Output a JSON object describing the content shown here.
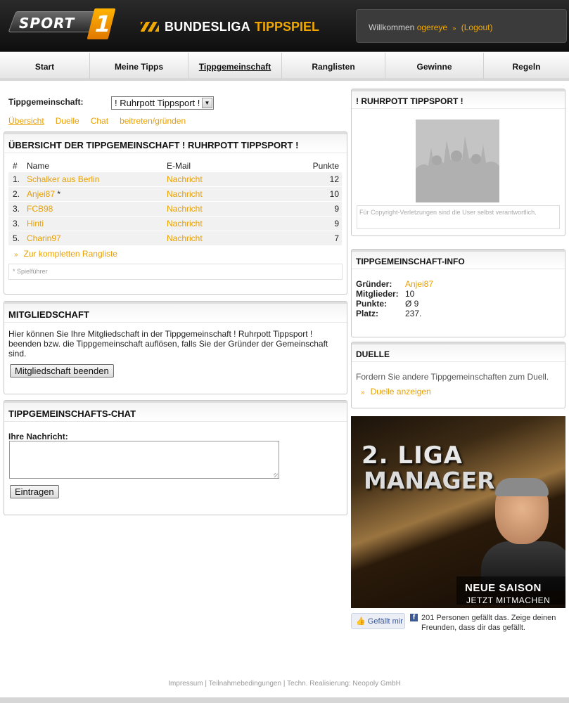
{
  "header": {
    "logo_text": "SPORT",
    "logo_one": "1",
    "brand_main": "BUNDESLIGA",
    "brand_accent": "TIPPSPIEL",
    "welcome_text": "Willkommen",
    "username": "ogereye",
    "logout": "(Logout)"
  },
  "nav": [
    {
      "label": "Start"
    },
    {
      "label": "Meine Tipps"
    },
    {
      "label": "Tippgemeinschaft",
      "active": true
    },
    {
      "label": "Ranglisten"
    },
    {
      "label": "Gewinne"
    },
    {
      "label": "Regeln"
    }
  ],
  "tip": {
    "label": "Tippgemeinschaft:",
    "selected": "! Ruhrpott Tippsport !"
  },
  "subtabs": [
    {
      "label": "Übersicht",
      "active": true
    },
    {
      "label": "Duelle"
    },
    {
      "label": "Chat"
    },
    {
      "label": "beitreten/gründen"
    }
  ],
  "overview": {
    "title": "ÜBERSICHT DER TIPPGEMEINSCHAFT ! RUHRPOTT TIPPSPORT !",
    "columns": [
      "#",
      "Name",
      "E-Mail",
      "Punkte"
    ],
    "rows": [
      {
        "rank": "1.",
        "name": "Schalker aus Berlin",
        "mark": "",
        "email": "Nachricht",
        "points": "12"
      },
      {
        "rank": "2.",
        "name": "Anjei87",
        "mark": "*",
        "email": "Nachricht",
        "points": "10"
      },
      {
        "rank": "3.",
        "name": "FCB98",
        "mark": "",
        "email": "Nachricht",
        "points": "9"
      },
      {
        "rank": "3.",
        "name": "Hinti",
        "mark": "",
        "email": "Nachricht",
        "points": "9"
      },
      {
        "rank": "5.",
        "name": "Charin97",
        "mark": "",
        "email": "Nachricht",
        "points": "7"
      }
    ],
    "more": "Zur kompletten Rangliste",
    "note": "* Spielführer"
  },
  "membership": {
    "title": "MITGLIEDSCHAFT",
    "text": "Hier können Sie Ihre Mitgliedschaft in der Tippgemeinschaft ! Ruhrpott Tippsport ! beenden bzw. die Tippgemeinschaft auflösen, falls Sie der Gründer der Gemeinschaft sind.",
    "button": "Mitgliedschaft beenden"
  },
  "chat": {
    "title": "TIPPGEMEINSCHAFTS-CHAT",
    "label": "Ihre Nachricht:",
    "button": "Eintragen"
  },
  "side_group": {
    "title": "! RUHRPOTT TIPPSPORT !",
    "copyright": "Für Copyright-Verletzungen sind die User selbst verantwortlich."
  },
  "info": {
    "title": "TIPPGEMEINSCHAFT-INFO",
    "founder_l": "Gründer:",
    "founder_v": "Anjei87",
    "members_l": "Mitglieder:",
    "members_v": "10",
    "points_l": "Punkte:",
    "points_v": "Ø 9",
    "place_l": "Platz:",
    "place_v": "237."
  },
  "duels": {
    "title": "DUELLE",
    "text": "Fordern Sie andere Tippgemeinschaften zum Duell.",
    "link": "Duelle anzeigen"
  },
  "ad": {
    "line1": "2. LIGA",
    "line2": "MANAGER",
    "line3": "NEUE SAISON",
    "line4": "JETZT MITMACHEN"
  },
  "like": {
    "button": "Gefällt mir",
    "text": "201 Personen gefällt das. Zeige deinen Freunden, dass dir das gefällt."
  },
  "footer": {
    "impressum": "Impressum",
    "sep1": " | ",
    "terms": "Teilnahmebedingungen",
    "sep2": " | ",
    "tech": "Techn. Realisierung: Neopoly GmbH"
  },
  "colors": {
    "accent": "#e8a000",
    "header_bg": "#1a1a1a"
  }
}
